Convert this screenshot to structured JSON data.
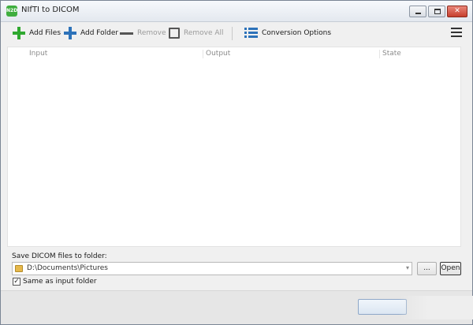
{
  "window": {
    "title": "NIfTI to DICOM",
    "app_icon_text": "N2D",
    "close_glyph": "✕"
  },
  "toolbar": {
    "add_files": "Add Files",
    "add_folder": "Add Folder",
    "remove": "Remove",
    "remove_all": "Remove All",
    "conversion_options": "Conversion Options"
  },
  "list": {
    "columns": [
      "Input",
      "Output",
      "State"
    ],
    "rows": []
  },
  "output": {
    "save_label": "Save DICOM files to folder:",
    "folder_path": "D:\\Documents\\Pictures",
    "dropdown_glyph": "▾",
    "browse_label": "...",
    "open_label": "Open",
    "same_as_input_label": "Same as input folder",
    "same_as_input_checked": true,
    "check_glyph": "✓"
  },
  "colors": {
    "add_green": "#2fa82f",
    "add_blue": "#2d72b9",
    "accent": "#2d72b9"
  }
}
